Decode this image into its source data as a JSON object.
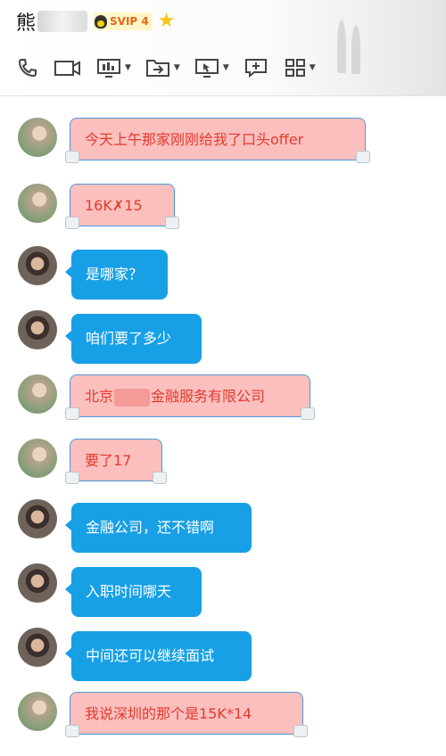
{
  "header": {
    "contact_name": "熊",
    "vip_label": "SVIP 4"
  },
  "messages": [
    {
      "text": "今天上午那家刚刚给我了口头offer",
      "style": "pink"
    },
    {
      "text": "16K✗15",
      "style": "pink"
    },
    {
      "text": "是哪家？",
      "style": "blue"
    },
    {
      "text": "咱们要了多少",
      "style": "blue"
    },
    {
      "text_before": "北京",
      "text_after": "金融服务有限公司",
      "style": "pink"
    },
    {
      "text": "要了17",
      "style": "pink"
    },
    {
      "text": "金融公司，还不错啊",
      "style": "blue"
    },
    {
      "text": "入职时间哪天",
      "style": "blue"
    },
    {
      "text": "中间还可以继续面试",
      "style": "blue"
    },
    {
      "text": "我说深圳的那个是15K*14",
      "style": "pink"
    }
  ],
  "colors": {
    "pink_bubble": "#fbbfbe",
    "pink_text": "#e33b2e",
    "blue_bubble": "#17a0e6",
    "vip_text": "#e8651a",
    "star": "#f5c71a"
  },
  "icons": [
    "phone-icon",
    "video-call-icon",
    "screen-share-icon",
    "file-transfer-icon",
    "remote-desktop-icon",
    "add-message-icon",
    "apps-grid-icon",
    "star-icon",
    "penguin-icon"
  ]
}
